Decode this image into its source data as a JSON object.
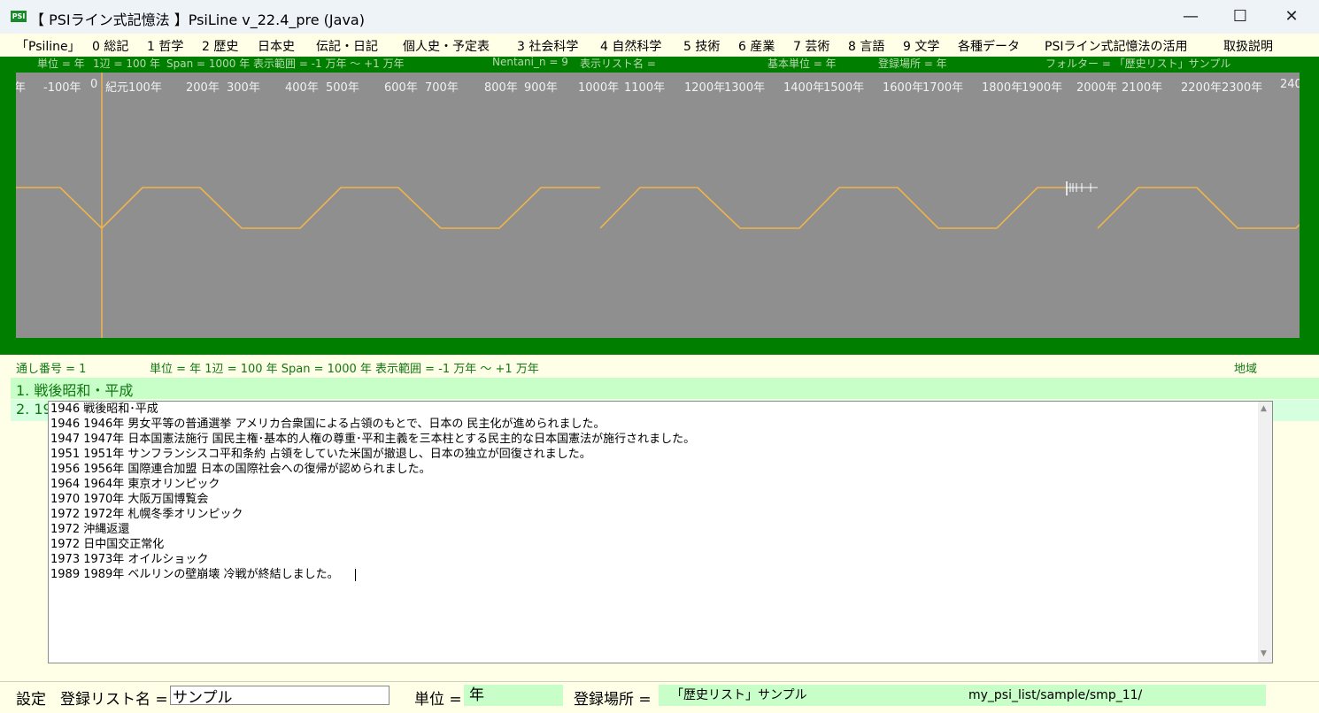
{
  "window": {
    "icon_text": "PSI",
    "title": "【 PSIライン式記憶法 】PsiLine v_22.4_pre (Java)",
    "minimize": "—",
    "maximize": "☐",
    "close": "✕"
  },
  "menu": [
    "「Psiline」",
    "0 総記",
    "1 哲学",
    "2 歴史",
    "日本史",
    "伝記・日記",
    "個人史・予定表",
    "3 社会科学",
    "4 自然科学",
    "5 技術",
    "6 産業",
    "7 芸術",
    "8 言語",
    "9 文学",
    "各種データ",
    "PSIライン式記憶法の活用",
    "取扱説明"
  ],
  "timeline_info": {
    "unit": "単位 = 年",
    "side": "1辺 = 100 年",
    "span": "Span = 1000 年",
    "range": "表示範囲 = -1 万年 ～ +1 万年",
    "nentani": "Nentani_n = 9",
    "list_name": "表示リスト名 =",
    "base_unit": "基本単位 = 年",
    "location": "登録場所 = 年",
    "folder": "フォルター = 「歴史リスト」サンプル"
  },
  "ticks": [
    "年",
    "-100年",
    "0",
    "紀元",
    "100年",
    "200年",
    "300年",
    "400年",
    "500年",
    "600年",
    "700年",
    "800年",
    "900年",
    "1000年",
    "1100年",
    "1200年",
    "1300年",
    "1400年",
    "1500年",
    "1600年",
    "1700年",
    "1800年",
    "1900年",
    "2000年",
    "2100年",
    "2200年",
    "2300年",
    "240"
  ],
  "info2": {
    "serial": "通し番号 = 1",
    "unit_line": "単位 = 年  1辺 = 100 年  Span = 1000 年  表示範囲 = -1 万年 ～ +1 万年",
    "region": "地域"
  },
  "rows": {
    "row1": "1. 戦後昭和・平成",
    "row2": "2. 19"
  },
  "text_lines": [
    "1946  戦後昭和･平成",
    "1946  1946年 男女平等の普通選挙 アメリカ合衆国による占領のもとで、日本の 民主化が進められました。",
    "1947  1947年 日本国憲法施行 国民主権･基本的人権の尊重･平和主義を三本柱とする民主的な日本国憲法が施行されました。",
    "1951  1951年 サンフランシスコ平和条約 占領をしていた米国が撤退し、日本の独立が回復されました。",
    "1956  1956年 国際連合加盟 日本の国際社会への復帰が認められました。",
    "1964  1964年 東京オリンピック",
    "1970  1970年 大阪万国博覧会",
    "1972  1972年 札幌冬季オリンピック",
    "1972  沖縄返還",
    "1972  日中国交正常化",
    "1973  1973年 オイルショック",
    "1989  1989年 ベルリンの壁崩壊 冷戦が終結しました。"
  ],
  "scroll": {
    "up": "▲",
    "down": "▼"
  },
  "bottom": {
    "settings": "設定",
    "list_name_label": "登録リスト名 =",
    "list_name_value": "サンプル",
    "unit_label": "単位 =",
    "unit_value": "年",
    "location_label": "登録場所 =",
    "location_value": "「歴史リスト」サンプル",
    "path": "my_psi_list/sample/smp_11/"
  },
  "colors": {
    "frame_green": "#007e00",
    "canvas_gray": "#8f8f8f",
    "line_orange": "#f0b44a",
    "highlight_green": "#c8ffc8"
  }
}
